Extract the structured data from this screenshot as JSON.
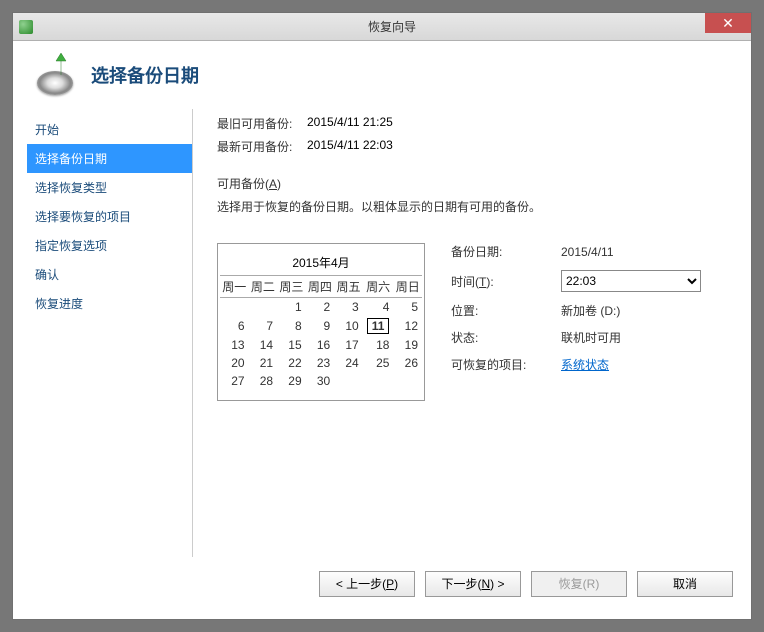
{
  "titlebar": {
    "title": "恢复向导",
    "close": "✕"
  },
  "header": {
    "title": "选择备份日期"
  },
  "sidebar": {
    "items": [
      {
        "label": "开始"
      },
      {
        "label": "选择备份日期"
      },
      {
        "label": "选择恢复类型"
      },
      {
        "label": "选择要恢复的项目"
      },
      {
        "label": "指定恢复选项"
      },
      {
        "label": "确认"
      },
      {
        "label": "恢复进度"
      }
    ]
  },
  "info": {
    "oldest_label": "最旧可用备份:",
    "oldest_value": "2015/4/11 21:25",
    "newest_label": "最新可用备份:",
    "newest_value": "2015/4/11 22:03"
  },
  "available": {
    "title_pre": "可用备份(",
    "title_hot": "A",
    "title_post": ")",
    "desc": "选择用于恢复的备份日期。以粗体显示的日期有可用的备份。"
  },
  "calendar": {
    "title": "2015年4月",
    "dow": [
      "周一",
      "周二",
      "周三",
      "周四",
      "周五",
      "周六",
      "周日"
    ],
    "weeks": [
      [
        {
          "d": ""
        },
        {
          "d": ""
        },
        {
          "d": "1"
        },
        {
          "d": "2"
        },
        {
          "d": "3"
        },
        {
          "d": "4"
        },
        {
          "d": "5"
        }
      ],
      [
        {
          "d": "6"
        },
        {
          "d": "7"
        },
        {
          "d": "8"
        },
        {
          "d": "9"
        },
        {
          "d": "10"
        },
        {
          "d": "11",
          "bold": true,
          "selected": true
        },
        {
          "d": "12"
        }
      ],
      [
        {
          "d": "13"
        },
        {
          "d": "14"
        },
        {
          "d": "15"
        },
        {
          "d": "16"
        },
        {
          "d": "17"
        },
        {
          "d": "18"
        },
        {
          "d": "19"
        }
      ],
      [
        {
          "d": "20"
        },
        {
          "d": "21"
        },
        {
          "d": "22"
        },
        {
          "d": "23"
        },
        {
          "d": "24"
        },
        {
          "d": "25"
        },
        {
          "d": "26"
        }
      ],
      [
        {
          "d": "27"
        },
        {
          "d": "28"
        },
        {
          "d": "29"
        },
        {
          "d": "30"
        },
        {
          "d": ""
        },
        {
          "d": ""
        },
        {
          "d": ""
        }
      ]
    ]
  },
  "details": {
    "backup_date_label": "备份日期:",
    "backup_date_value": "2015/4/11",
    "time_label_pre": "时间(",
    "time_label_hot": "T",
    "time_label_post": "):",
    "time_value": "22:03",
    "location_label": "位置:",
    "location_value": "新加卷 (D:)",
    "status_label": "状态:",
    "status_value": "联机时可用",
    "recoverable_label": "可恢复的项目:",
    "recoverable_value": "系统状态"
  },
  "footer": {
    "prev_pre": "< 上一步(",
    "prev_hot": "P",
    "prev_post": ")",
    "next_pre": "下一步(",
    "next_hot": "N",
    "next_post": ") >",
    "recover_pre": "恢复(",
    "recover_hot": "R",
    "recover_post": ")",
    "cancel": "取消"
  }
}
